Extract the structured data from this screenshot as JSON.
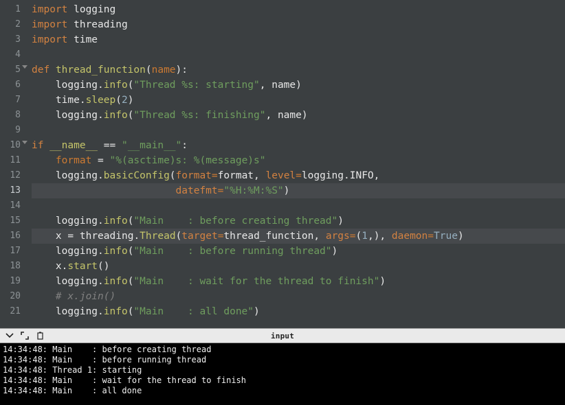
{
  "panel": {
    "label": "input"
  },
  "code": {
    "lines": [
      {
        "n": "1",
        "fold": false,
        "hl": false,
        "tokens": [
          [
            "kw",
            "import "
          ],
          [
            "id",
            "logging"
          ]
        ]
      },
      {
        "n": "2",
        "fold": false,
        "hl": false,
        "tokens": [
          [
            "kw",
            "import "
          ],
          [
            "id",
            "threading"
          ]
        ]
      },
      {
        "n": "3",
        "fold": false,
        "hl": false,
        "tokens": [
          [
            "kw",
            "import "
          ],
          [
            "id",
            "time"
          ]
        ]
      },
      {
        "n": "4",
        "fold": false,
        "hl": false,
        "tokens": []
      },
      {
        "n": "5",
        "fold": true,
        "hl": false,
        "tokens": [
          [
            "kw",
            "def "
          ],
          [
            "fn",
            "thread_function"
          ],
          [
            "op",
            "("
          ],
          [
            "arg",
            "name"
          ],
          [
            "op",
            "):"
          ]
        ]
      },
      {
        "n": "6",
        "fold": false,
        "hl": false,
        "tokens": [
          [
            "id",
            "    logging"
          ],
          [
            "op",
            "."
          ],
          [
            "fn",
            "info"
          ],
          [
            "op",
            "("
          ],
          [
            "str",
            "\"Thread %s: starting\""
          ],
          [
            "op",
            ", "
          ],
          [
            "id",
            "name"
          ],
          [
            "op",
            ")"
          ]
        ]
      },
      {
        "n": "7",
        "fold": false,
        "hl": false,
        "tokens": [
          [
            "id",
            "    time"
          ],
          [
            "op",
            "."
          ],
          [
            "fn",
            "sleep"
          ],
          [
            "op",
            "("
          ],
          [
            "num",
            "2"
          ],
          [
            "op",
            ")"
          ]
        ]
      },
      {
        "n": "8",
        "fold": false,
        "hl": false,
        "tokens": [
          [
            "id",
            "    logging"
          ],
          [
            "op",
            "."
          ],
          [
            "fn",
            "info"
          ],
          [
            "op",
            "("
          ],
          [
            "str",
            "\"Thread %s: finishing\""
          ],
          [
            "op",
            ", "
          ],
          [
            "id",
            "name"
          ],
          [
            "op",
            ")"
          ]
        ]
      },
      {
        "n": "9",
        "fold": false,
        "hl": false,
        "tokens": []
      },
      {
        "n": "10",
        "fold": true,
        "hl": false,
        "tokens": [
          [
            "kw",
            "if "
          ],
          [
            "mag",
            "__name__"
          ],
          [
            "op",
            " == "
          ],
          [
            "str",
            "\"__main__\""
          ],
          [
            "op",
            ":"
          ]
        ]
      },
      {
        "n": "11",
        "fold": false,
        "hl": false,
        "tokens": [
          [
            "id",
            "    "
          ],
          [
            "arg",
            "format"
          ],
          [
            "op",
            " = "
          ],
          [
            "str",
            "\"%(asctime)s: %(message)s\""
          ]
        ]
      },
      {
        "n": "12",
        "fold": false,
        "hl": false,
        "tokens": [
          [
            "id",
            "    logging"
          ],
          [
            "op",
            "."
          ],
          [
            "fn",
            "basicConfig"
          ],
          [
            "op",
            "("
          ],
          [
            "kw2",
            "format"
          ],
          [
            "eq",
            "="
          ],
          [
            "id",
            "format"
          ],
          [
            "op",
            ", "
          ],
          [
            "kw2",
            "level"
          ],
          [
            "eq",
            "="
          ],
          [
            "id",
            "logging.INFO"
          ],
          [
            "op",
            ","
          ]
        ]
      },
      {
        "n": "13",
        "fold": false,
        "hl": true,
        "tokens": [
          [
            "id",
            "                        "
          ],
          [
            "kw2",
            "datefmt"
          ],
          [
            "eq",
            "="
          ],
          [
            "str",
            "\"%H:%M:%S\""
          ],
          [
            "op",
            ")"
          ]
        ]
      },
      {
        "n": "14",
        "fold": false,
        "hl": false,
        "tokens": []
      },
      {
        "n": "15",
        "fold": false,
        "hl": false,
        "tokens": [
          [
            "id",
            "    logging"
          ],
          [
            "op",
            "."
          ],
          [
            "fn",
            "info"
          ],
          [
            "op",
            "("
          ],
          [
            "str",
            "\"Main    : before creating thread\""
          ],
          [
            "op",
            ")"
          ]
        ]
      },
      {
        "n": "16",
        "fold": false,
        "hl": true,
        "tokens": [
          [
            "id",
            "    x "
          ],
          [
            "op",
            "= "
          ],
          [
            "id",
            "threading"
          ],
          [
            "op",
            "."
          ],
          [
            "fn",
            "Thread"
          ],
          [
            "op",
            "("
          ],
          [
            "kw2",
            "target"
          ],
          [
            "eq",
            "="
          ],
          [
            "id",
            "thread_function"
          ],
          [
            "op",
            ", "
          ],
          [
            "kw2",
            "args"
          ],
          [
            "eq",
            "="
          ],
          [
            "op",
            "("
          ],
          [
            "num",
            "1"
          ],
          [
            "op",
            ",), "
          ],
          [
            "kw2",
            "daemon"
          ],
          [
            "eq",
            "="
          ],
          [
            "bi",
            "True"
          ],
          [
            "op",
            ")"
          ]
        ]
      },
      {
        "n": "17",
        "fold": false,
        "hl": false,
        "tokens": [
          [
            "id",
            "    logging"
          ],
          [
            "op",
            "."
          ],
          [
            "fn",
            "info"
          ],
          [
            "op",
            "("
          ],
          [
            "str",
            "\"Main    : before running thread\""
          ],
          [
            "op",
            ")"
          ]
        ]
      },
      {
        "n": "18",
        "fold": false,
        "hl": false,
        "tokens": [
          [
            "id",
            "    x"
          ],
          [
            "op",
            "."
          ],
          [
            "fn",
            "start"
          ],
          [
            "op",
            "()"
          ]
        ]
      },
      {
        "n": "19",
        "fold": false,
        "hl": false,
        "tokens": [
          [
            "id",
            "    logging"
          ],
          [
            "op",
            "."
          ],
          [
            "fn",
            "info"
          ],
          [
            "op",
            "("
          ],
          [
            "str",
            "\"Main    : wait for the thread to finish\""
          ],
          [
            "op",
            ")"
          ]
        ]
      },
      {
        "n": "20",
        "fold": false,
        "hl": false,
        "tokens": [
          [
            "id",
            "    "
          ],
          [
            "cmt",
            "# x.join()"
          ]
        ]
      },
      {
        "n": "21",
        "fold": false,
        "hl": false,
        "tokens": [
          [
            "id",
            "    logging"
          ],
          [
            "op",
            "."
          ],
          [
            "fn",
            "info"
          ],
          [
            "op",
            "("
          ],
          [
            "str",
            "\"Main    : all done\""
          ],
          [
            "op",
            ")"
          ]
        ]
      }
    ],
    "current_line": "13"
  },
  "console": {
    "lines": [
      "14:34:48: Main    : before creating thread",
      "14:34:48: Main    : before running thread",
      "14:34:48: Thread 1: starting",
      "14:34:48: Main    : wait for the thread to finish",
      "14:34:48: Main    : all done"
    ]
  }
}
